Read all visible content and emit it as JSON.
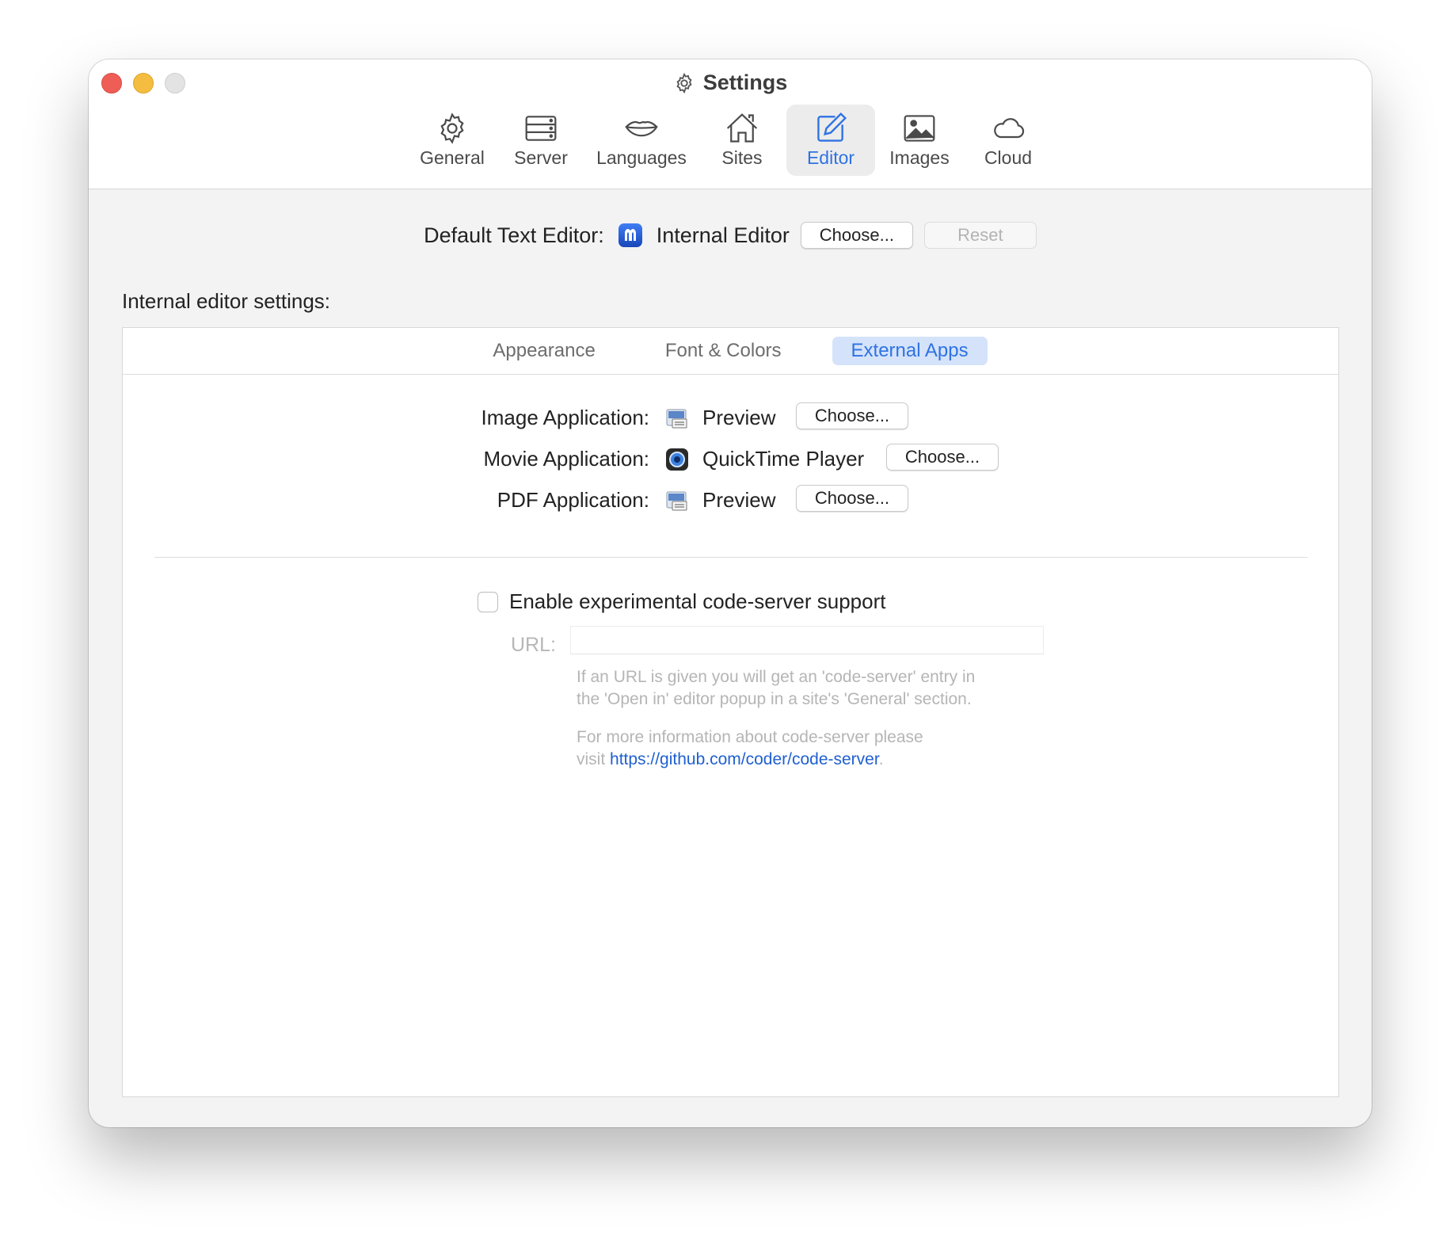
{
  "window": {
    "title": "Settings",
    "controls": [
      "close",
      "minimize",
      "zoom"
    ]
  },
  "toolbar": {
    "items": [
      {
        "label": "General",
        "icon": "gear-icon"
      },
      {
        "label": "Server",
        "icon": "server-icon"
      },
      {
        "label": "Languages",
        "icon": "lips-icon"
      },
      {
        "label": "Sites",
        "icon": "house-icon"
      },
      {
        "label": "Editor",
        "icon": "edit-icon",
        "active": true
      },
      {
        "label": "Images",
        "icon": "image-icon"
      },
      {
        "label": "Cloud",
        "icon": "cloud-icon"
      }
    ]
  },
  "default_editor": {
    "label": "Default Text Editor:",
    "app_name": "Internal Editor",
    "choose_label": "Choose...",
    "reset_label": "Reset"
  },
  "internal_settings": {
    "label": "Internal editor settings:",
    "tabs": [
      {
        "label": "Appearance"
      },
      {
        "label": "Font & Colors"
      },
      {
        "label": "External Apps",
        "active": true
      }
    ],
    "apps": [
      {
        "label": "Image Application:",
        "app": "Preview",
        "choose": "Choose..."
      },
      {
        "label": "Movie Application:",
        "app": "QuickTime Player",
        "choose": "Choose..."
      },
      {
        "label": "PDF Application:",
        "app": "Preview",
        "choose": "Choose..."
      }
    ],
    "code_server": {
      "checkbox_label": "Enable experimental code-server support",
      "checked": false,
      "url_label": "URL:",
      "url_value": "",
      "hint1_line1": "If an URL is given you will get an 'code-server' entry in",
      "hint1_line2": "the 'Open in' editor popup in a site's 'General' section.",
      "hint2_line1": "For more information about code-server please",
      "hint2_visit": "visit",
      "link": "https://github.com/coder/code-server",
      "hint2_end": "."
    }
  },
  "colors": {
    "accent": "#2f72e2",
    "link": "#1f5fd1",
    "close": "#ee5e56",
    "minimize": "#f4bd3f",
    "zoom": "#e3e3e3"
  }
}
